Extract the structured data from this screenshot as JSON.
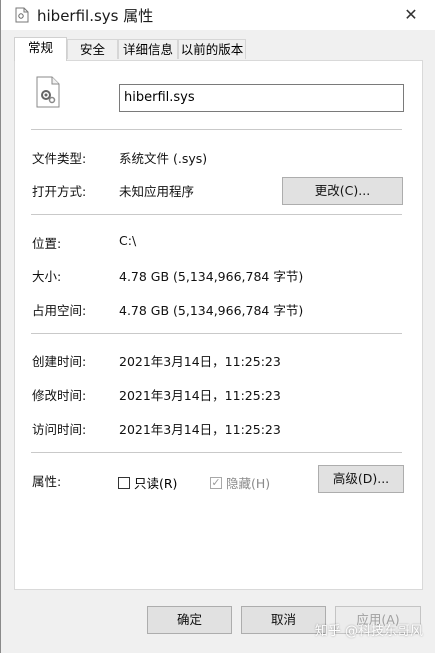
{
  "window": {
    "title": "hiberfil.sys 属性",
    "close_glyph": "✕"
  },
  "tabs": [
    {
      "label": "常规",
      "active": true
    },
    {
      "label": "安全",
      "active": false
    },
    {
      "label": "详细信息",
      "active": false
    },
    {
      "label": "以前的版本",
      "active": false
    }
  ],
  "general": {
    "file_name": "hiberfil.sys",
    "file_type_label": "文件类型:",
    "file_type_value": "系统文件 (.sys)",
    "open_with_label": "打开方式:",
    "open_with_value": "未知应用程序",
    "change_button": "更改(C)...",
    "location_label": "位置:",
    "location_value": "C:\\",
    "size_label": "大小:",
    "size_value": "4.78 GB (5,134,966,784 字节)",
    "size_on_disk_label": "占用空间:",
    "size_on_disk_value": "4.78 GB (5,134,966,784 字节)",
    "created_label": "创建时间:",
    "created_value": "2021年3月14日，11:25:23",
    "modified_label": "修改时间:",
    "modified_value": "2021年3月14日，11:25:23",
    "accessed_label": "访问时间:",
    "accessed_value": "2021年3月14日，11:25:23",
    "attributes_label": "属性:",
    "readonly_label": "只读(R)",
    "readonly_checked": false,
    "hidden_label": "隐藏(H)",
    "hidden_checked": true,
    "advanced_button": "高级(D)..."
  },
  "footer": {
    "ok_button": "确定",
    "cancel_button": "取消",
    "apply_button": "应用(A)"
  },
  "watermark": "知乎 @科技东哥风",
  "colors": {
    "window_bg": "#f0f0f0",
    "panel_bg": "#ffffff",
    "button_bg": "#e1e1e1",
    "disabled_text": "#a0a0a0"
  }
}
